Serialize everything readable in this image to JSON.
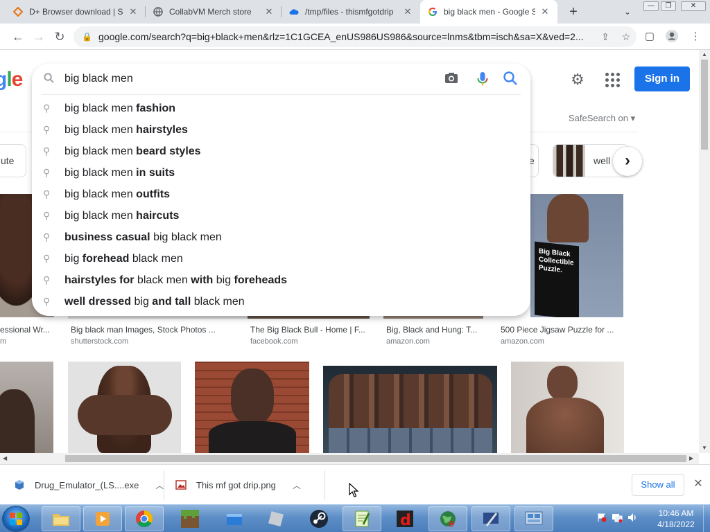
{
  "browser": {
    "tabs": [
      {
        "title": "D+ Browser download | S",
        "icon": "diamond-icon",
        "active": false
      },
      {
        "title": "CollabVM Merch store",
        "icon": "globe-icon",
        "active": false
      },
      {
        "title": "/tmp/files - thismfgotdrip",
        "icon": "cloud-icon",
        "active": false
      },
      {
        "title": "big black men - Google S",
        "icon": "google-icon",
        "active": true
      }
    ],
    "url": "google.com/search?q=big+black+men&rlz=1C1GCEA_enUS986US986&source=lnms&tbm=isch&sa=X&ved=2..."
  },
  "page": {
    "search_value": "big black men",
    "sign_in_label": "Sign in",
    "safesearch_label": "SafeSearch on ▾",
    "suggestions": [
      {
        "prefix": "big black men ",
        "bold": "fashion",
        "suffix": ""
      },
      {
        "prefix": "big black men ",
        "bold": "hairstyles",
        "suffix": ""
      },
      {
        "prefix": "big black men ",
        "bold": "beard styles",
        "suffix": ""
      },
      {
        "prefix": "big black men ",
        "bold": "in suits",
        "suffix": ""
      },
      {
        "prefix": "big black men ",
        "bold": "outfits",
        "suffix": ""
      },
      {
        "prefix": "big black men ",
        "bold": "haircuts",
        "suffix": ""
      },
      {
        "prefix": "",
        "bold": "business casual",
        "suffix": " big black men"
      },
      {
        "prefix": "big ",
        "bold": "forehead",
        "suffix": " black men"
      },
      {
        "prefix": "",
        "bold": "hairstyles for",
        "suffix": " black men ",
        "bold2": "with",
        "suffix2": " big ",
        "bold3": "foreheads"
      },
      {
        "prefix": "",
        "bold": "well dressed",
        "suffix": " big ",
        "bold2": "and tall",
        "suffix2": " black men"
      }
    ],
    "chips": {
      "left": "ute",
      "right_partial": "e",
      "well_label": "well"
    },
    "results_row1": [
      {
        "caption": "essional Wr...",
        "source": "m"
      },
      {
        "caption": "Big black man Images, Stock Photos ...",
        "source": "shutterstock.com"
      },
      {
        "caption": "The Big Black Bull - Home | F...",
        "source": "facebook.com"
      },
      {
        "caption": "Big, Black and Hung: T...",
        "source": "amazon.com"
      },
      {
        "caption": "500 Piece Jigsaw Puzzle for ...",
        "source": "amazon.com"
      }
    ],
    "puzzle_box_text": "Big Black Collectible Puzzle."
  },
  "downloads": {
    "items": [
      {
        "name": "Drug_Emulator_(LS....exe",
        "icon": "exe-icon"
      },
      {
        "name": "This mf got drip.png",
        "icon": "image-file-icon"
      }
    ],
    "show_all_label": "Show all"
  },
  "taskbar": {
    "time": "10:46 AM",
    "date": "4/18/2022"
  }
}
